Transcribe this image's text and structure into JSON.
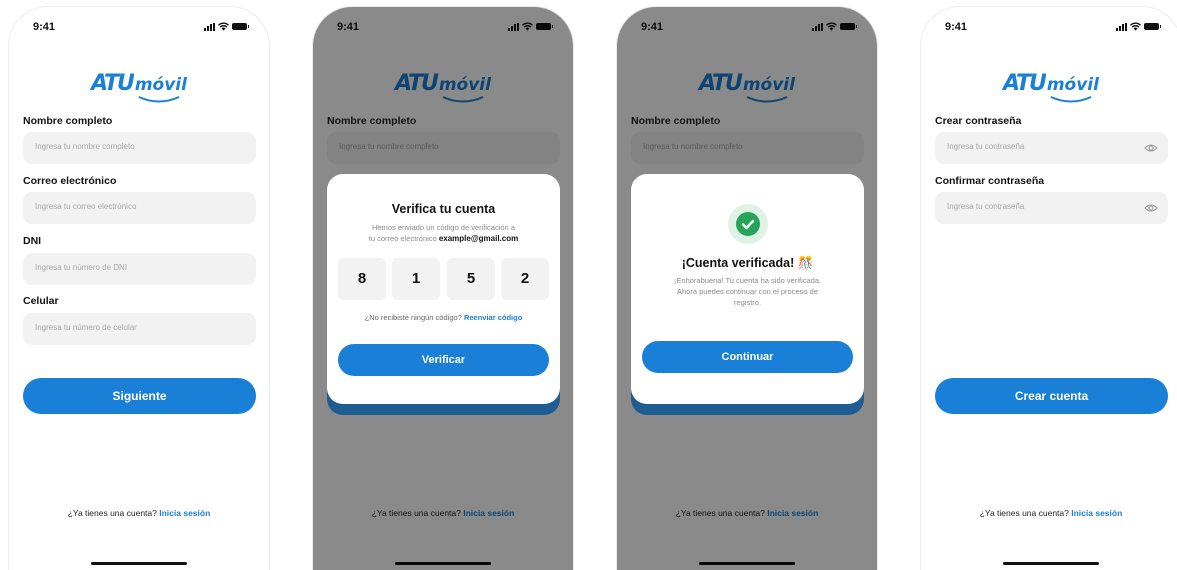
{
  "status_time": "9:41",
  "logo": {
    "left": "ATU",
    "right": "móvil"
  },
  "colors": {
    "accent": "#1a7fd6",
    "success": "#27a35a",
    "field_bg": "#f2f2f2"
  },
  "screen1": {
    "fields": [
      {
        "label": "Nombre completo",
        "placeholder": "Ingresa tu nombre completo"
      },
      {
        "label": "Correo electrónico",
        "placeholder": "Ingresa tu correo electrónico"
      },
      {
        "label": "DNI",
        "placeholder": "Ingresa tu número de DNI"
      },
      {
        "label": "Celular",
        "placeholder": "Ingresa tu número de celular"
      }
    ],
    "next_button": "Siguiente"
  },
  "login_prompt": {
    "text": "¿Ya tienes una cuenta?",
    "link": "Inicia sesión"
  },
  "verify_modal": {
    "title": "Verifica tu cuenta",
    "line1": "Hemos enviado un código de verificación a",
    "line2": "tu correo electrónico",
    "email": "example@gmail.com",
    "digits": [
      "8",
      "1",
      "5",
      "2"
    ],
    "resend_text": "¿No recibiste ningún código?",
    "resend_link": "Reenviar código",
    "button": "Verificar"
  },
  "verified_modal": {
    "title": "¡Cuenta verificada! 🎊",
    "line1": "¡Enhorabuena! Tu cuenta ha sido verificada.",
    "line2": "Ahora puedes continuar con el proceso de",
    "line3": "registro.",
    "button": "Continuar"
  },
  "screen4": {
    "fields": [
      {
        "label": "Crear contraseña",
        "placeholder": "Ingresa tu contraseña"
      },
      {
        "label": "Confirmar contraseña",
        "placeholder": "Ingresa tu contraseña"
      }
    ],
    "create_button": "Crear cuenta"
  }
}
